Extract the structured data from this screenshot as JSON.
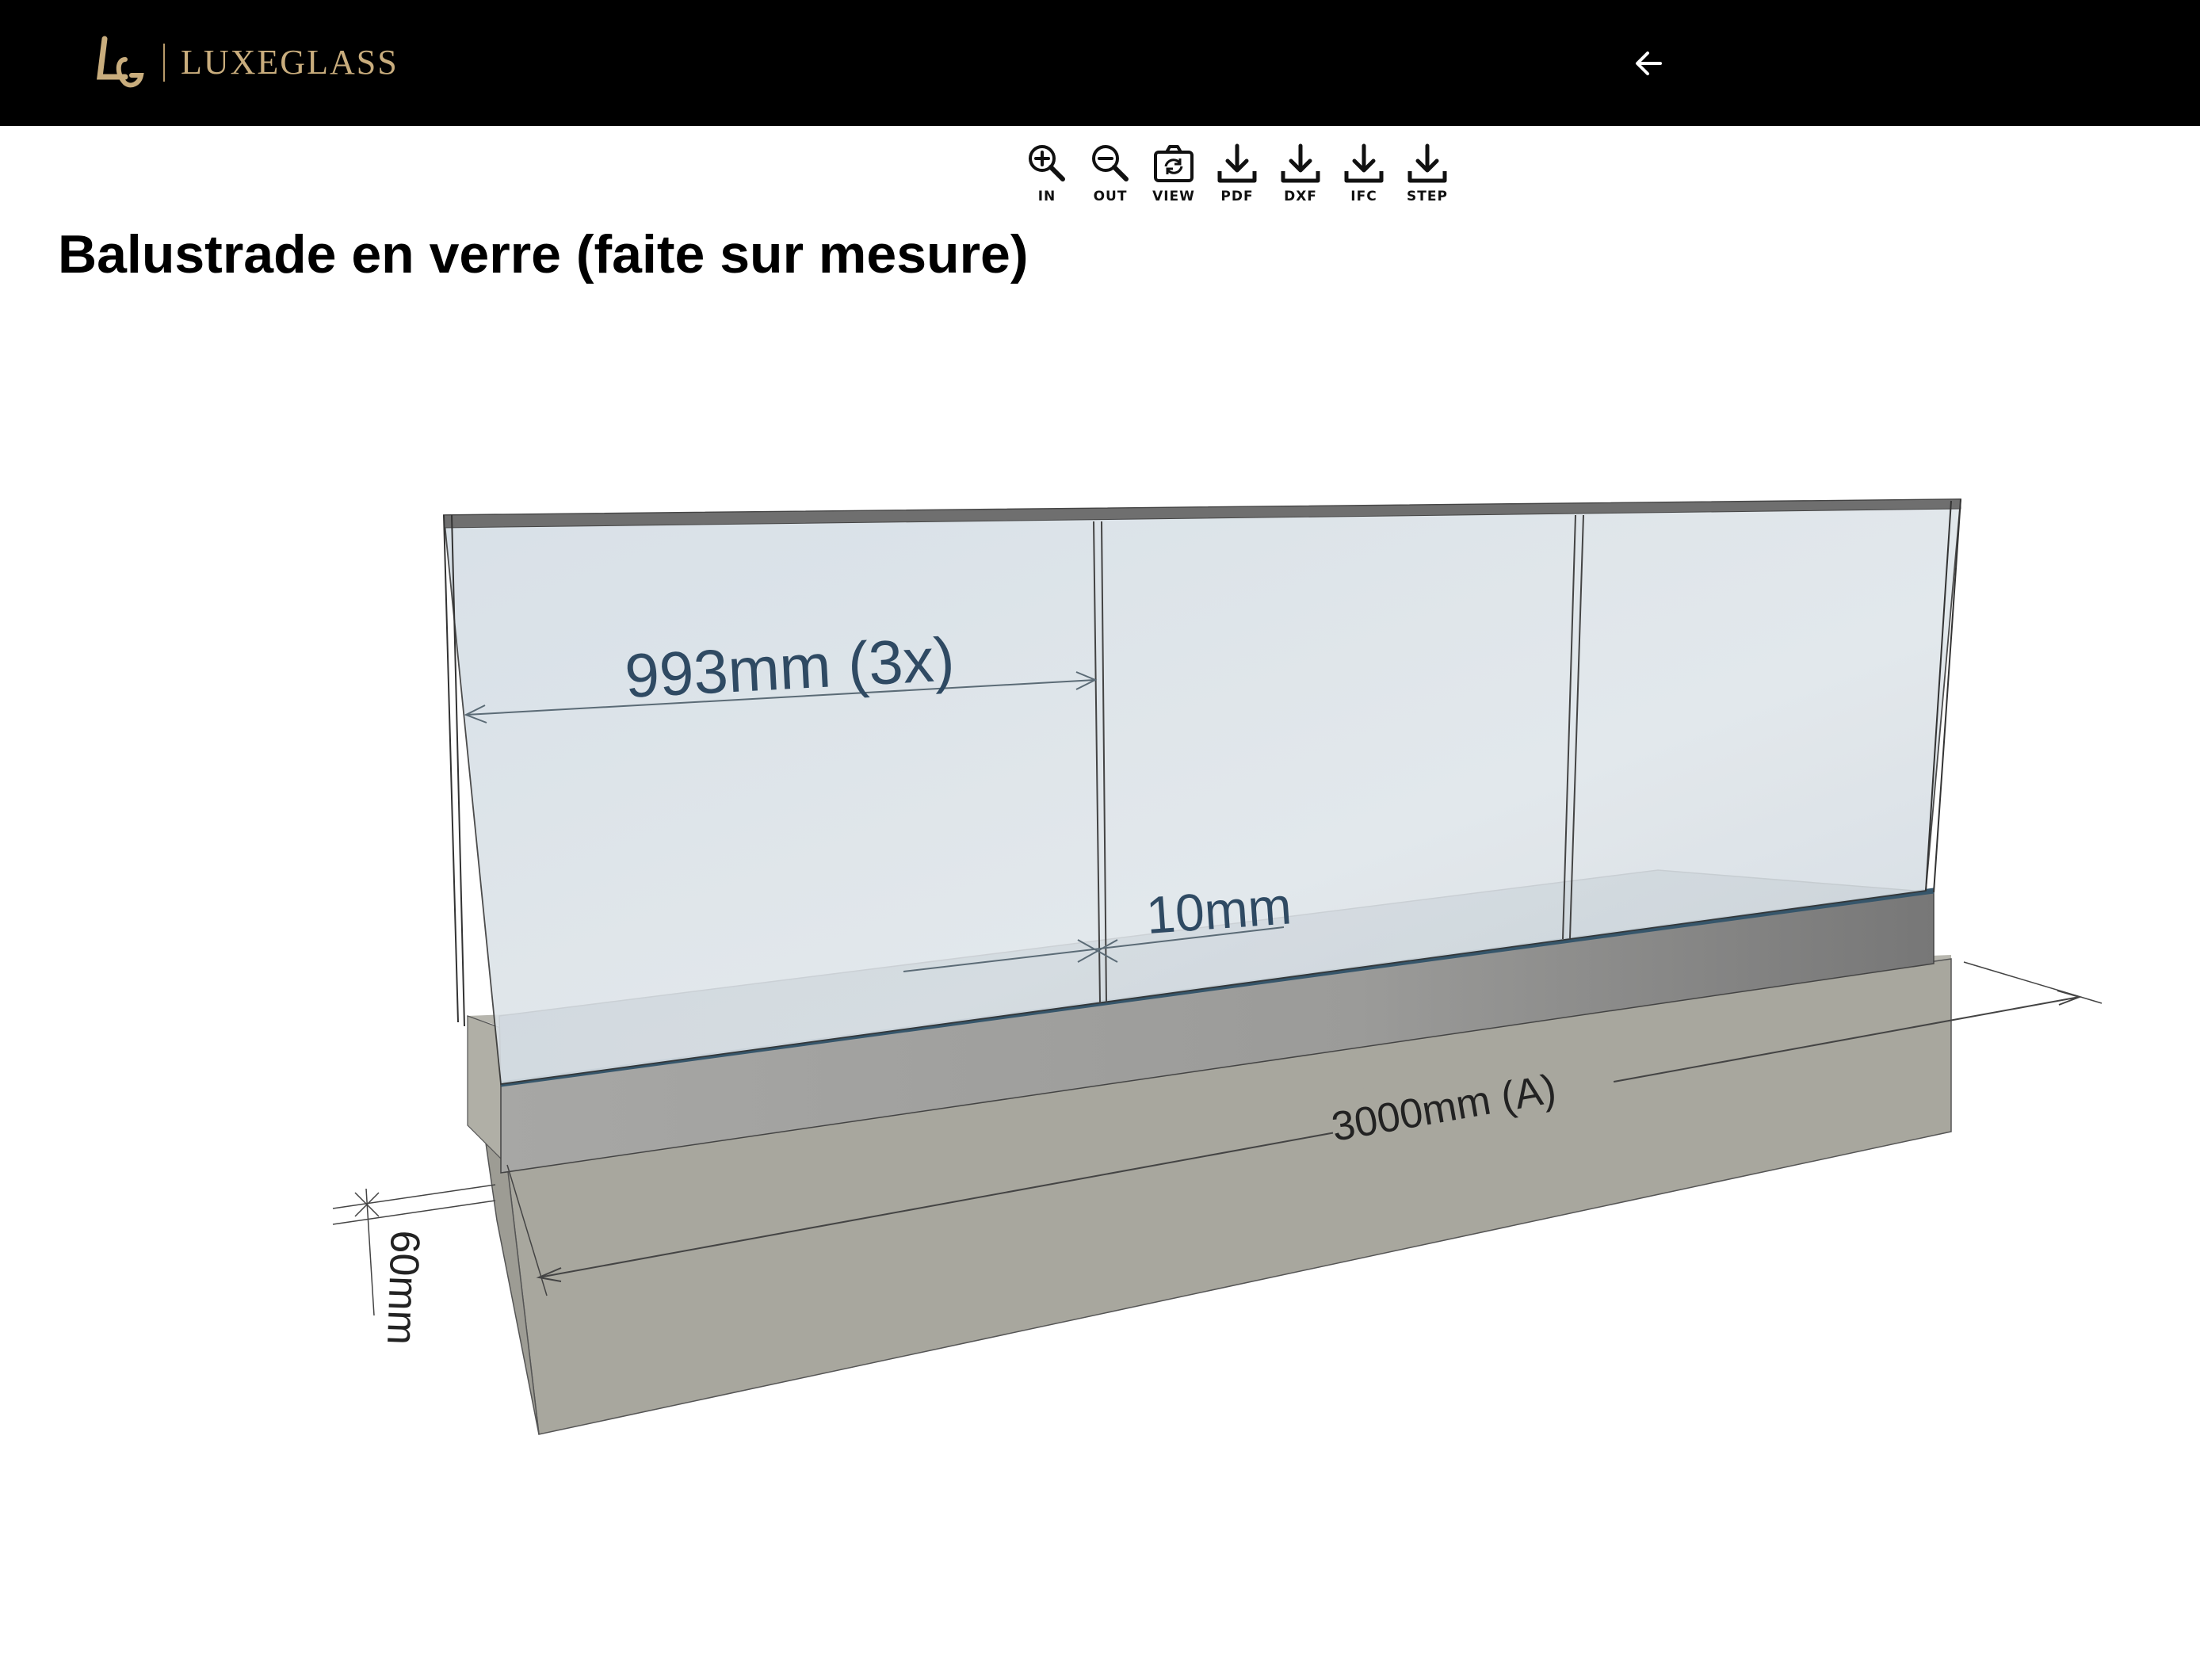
{
  "header": {
    "brand": "LUXEGLASS",
    "logo_icon": "lg-monogram-logo",
    "back_icon": "arrow-left-icon",
    "colors": {
      "background": "#000000",
      "brand_gold": "#c9ad7d"
    }
  },
  "toolbar": {
    "buttons": [
      {
        "label": "IN",
        "icon": "zoom-in-icon"
      },
      {
        "label": "OUT",
        "icon": "zoom-out-icon"
      },
      {
        "label": "VIEW",
        "icon": "rotate-view-icon"
      },
      {
        "label": "PDF",
        "icon": "download-icon"
      },
      {
        "label": "DXF",
        "icon": "download-icon"
      },
      {
        "label": "IFC",
        "icon": "download-icon"
      },
      {
        "label": "STEP",
        "icon": "download-icon"
      }
    ]
  },
  "page": {
    "title": "Balustrade en verre (faite sur mesure)"
  },
  "drawing": {
    "panel_width_label": "993mm (3x)",
    "glass_thickness_label": "10mm",
    "total_length_label": "3000mm (A)",
    "base_height_label": "60mm",
    "colors": {
      "glass": "#d7e0e6",
      "base": "#a9a89f",
      "profile": "#8a8a8a",
      "dimension_text": "#2f4a63"
    }
  }
}
